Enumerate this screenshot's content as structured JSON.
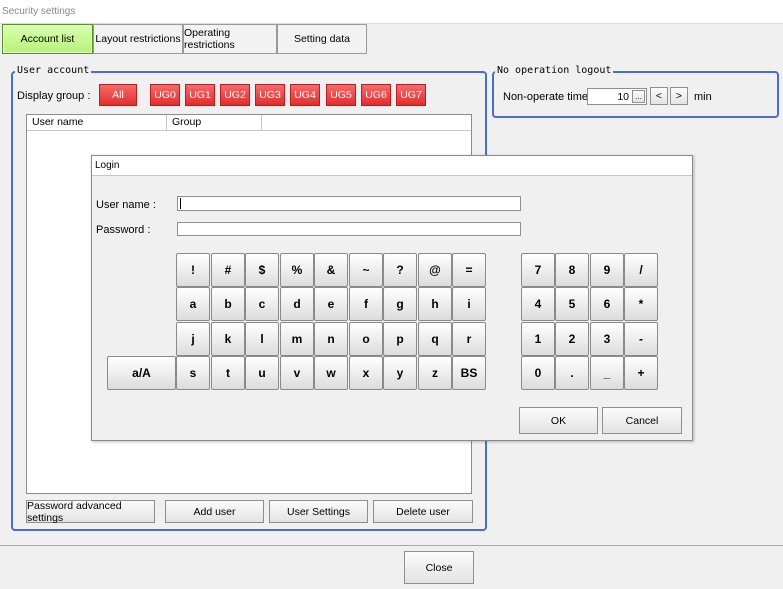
{
  "window": {
    "title": "Security settings"
  },
  "tabs": [
    {
      "label": "Account list"
    },
    {
      "label": "Layout restrictions"
    },
    {
      "label": "Operating restrictions"
    },
    {
      "label": "Setting data"
    }
  ],
  "user_account": {
    "legend": "User account",
    "display_group_label": "Display group :",
    "groups": [
      "All",
      "UG0",
      "UG1",
      "UG2",
      "UG3",
      "UG4",
      "UG5",
      "UG6",
      "UG7"
    ],
    "columns": [
      "User name",
      "Group"
    ],
    "buttons": {
      "password_advanced": "Password advanced settings",
      "add_user": "Add user",
      "user_settings": "User Settings",
      "delete_user": "Delete user"
    }
  },
  "no_operation_logout": {
    "legend": "No operation logout",
    "label": "Non-operate time :",
    "value": "10",
    "ellipsis": "...",
    "decrement": "<",
    "increment": ">",
    "unit": "min"
  },
  "login_dialog": {
    "title": "Login",
    "username_label": "User name :",
    "username_value": "",
    "password_label": "Password :",
    "password_value": "",
    "case_toggle": "a/A",
    "keyboard_rows": [
      [
        "!",
        "#",
        "$",
        "%",
        "&",
        "~",
        "?",
        "@",
        "="
      ],
      [
        "a",
        "b",
        "c",
        "d",
        "e",
        "f",
        "g",
        "h",
        "i"
      ],
      [
        "j",
        "k",
        "l",
        "m",
        "n",
        "o",
        "p",
        "q",
        "r"
      ],
      [
        "s",
        "t",
        "u",
        "v",
        "w",
        "x",
        "y",
        "z",
        "BS"
      ]
    ],
    "numpad_rows": [
      [
        "7",
        "8",
        "9",
        "/"
      ],
      [
        "4",
        "5",
        "6",
        "*"
      ],
      [
        "1",
        "2",
        "3",
        "-"
      ],
      [
        "0",
        ".",
        "_",
        "+"
      ]
    ],
    "ok": "OK",
    "cancel": "Cancel"
  },
  "footer": {
    "close": "Close"
  },
  "colors": {
    "active_tab": "#b8f27a",
    "group_button": "#e02e2e",
    "group_border": "#4a6fc7"
  }
}
